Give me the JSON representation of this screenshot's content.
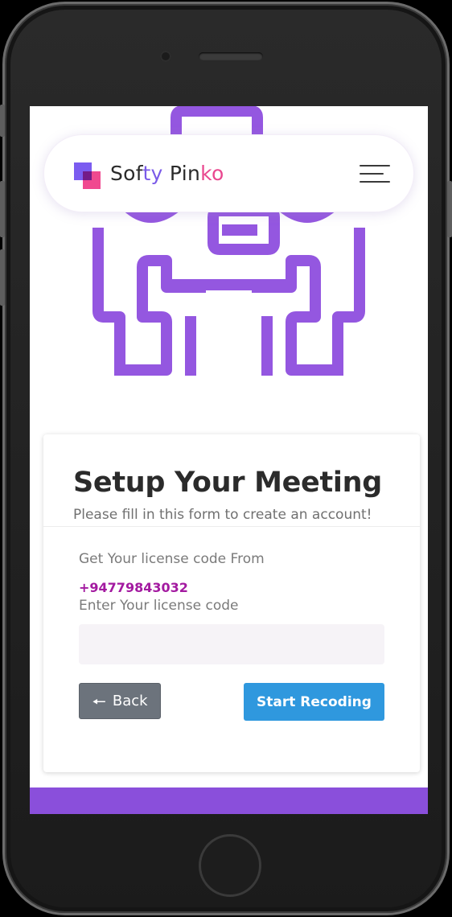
{
  "navbar": {
    "brand_part1": "Sof",
    "brand_part2": "ty",
    "brand_part3": " Pin",
    "brand_part4": "ko",
    "menu_icon": "hamburger-menu-icon"
  },
  "card": {
    "title": "Setup Your Meeting",
    "subtitle": "Please fill in this form to create an account!",
    "license_source_label": "Get Your license code From",
    "license_phone": "+94779843032",
    "license_input_label": "Enter Your license code",
    "license_input_value": "",
    "license_input_placeholder": ""
  },
  "buttons": {
    "back_arrow": "🠔",
    "back_label": "Back",
    "start_label": "Start Recoding"
  },
  "colors": {
    "illustration": "#9457e0",
    "brand_purple": "#7a5ae8",
    "brand_pink": "#e9478f",
    "link": "#a31aa0",
    "back_button": "#6c737c",
    "start_button": "#2f98de",
    "footer": "#8a4fdb"
  }
}
